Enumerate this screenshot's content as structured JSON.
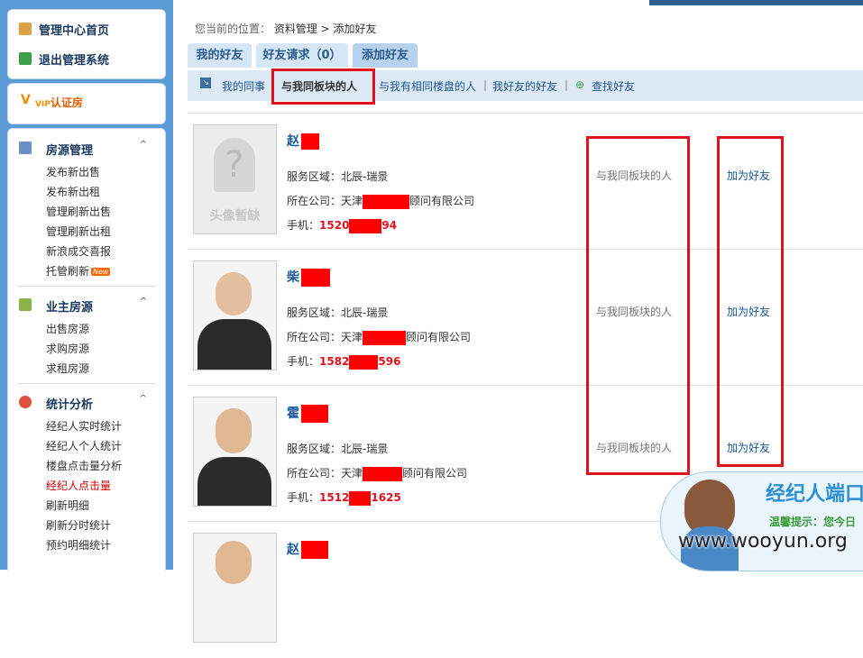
{
  "sidebar": {
    "top_links": [
      "管理中心首页",
      "退出管理系统"
    ],
    "vip_label": "认证房",
    "vip_prefix": "V",
    "sections": [
      {
        "title": "房源管理",
        "items": [
          "发布新出售",
          "发布新出租",
          "管理刷新出售",
          "管理刷新出租",
          "新浪成交喜报",
          "托管刷新"
        ]
      },
      {
        "title": "业主房源",
        "items": [
          "出售房源",
          "求购房源",
          "求租房源"
        ]
      },
      {
        "title": "统计分析",
        "items": [
          "经纪人实时统计",
          "经纪人个人统计",
          "楼盘点击量分析",
          "经纪人点击量",
          "刷新明细",
          "刷新分时统计",
          "预约明细统计"
        ]
      }
    ],
    "new_badge": "New",
    "caret": "^",
    "active_item": "经纪人点击量",
    "accent_color": "#5b9bd5"
  },
  "breadcrumb": {
    "prefix": "您当前的位置：",
    "path": "资料管理 > 添加好友"
  },
  "tabs": [
    "我的好友",
    "好友请求（0）",
    "添加好友"
  ],
  "subnav": {
    "items": [
      "我的同事",
      "与我同板块的人",
      "与我有相同楼盘的人",
      "我好友的好友",
      "查找好友"
    ],
    "separator": "|",
    "current": "与我同板块的人"
  },
  "people": [
    {
      "name": "赵",
      "area_label": "服务区域：",
      "area": "北辰-瑞景",
      "company_label": "所在公司：",
      "company_a": "天津",
      "company_b": "顾问有限公司",
      "phone_label": "手机：",
      "phone_a": "1520",
      "phone_b": "94",
      "relation": "与我同板块的人",
      "action": "加为好友",
      "avatar_text": "头像暂缺"
    },
    {
      "name": "柴",
      "area_label": "服务区域：",
      "area": "北辰-瑞景",
      "company_label": "所在公司：",
      "company_a": "天津",
      "company_b": "顾问有限公司",
      "phone_label": "手机：",
      "phone_a": "1582",
      "phone_b": "596",
      "relation": "与我同板块的人",
      "action": "加为好友",
      "avatar_text": ""
    },
    {
      "name": "霍",
      "area_label": "服务区域：",
      "area": "北辰-瑞景",
      "company_label": "所在公司：",
      "company_a": "天津",
      "company_b": "顾问有限公司",
      "phone_label": "手机：",
      "phone_a": "1512",
      "phone_b": "1625",
      "relation": "与我同板块的人",
      "action": "加为好友",
      "avatar_text": ""
    },
    {
      "name": "赵",
      "area_label": "",
      "area": "",
      "company_label": "",
      "company_a": "",
      "company_b": "",
      "phone_label": "",
      "phone_a": "",
      "phone_b": "",
      "relation": "",
      "action": "",
      "avatar_text": ""
    }
  ],
  "promo": {
    "title": "经纪人端口",
    "tip": "温馨提示：您今日"
  },
  "watermark": "www.wooyun.org"
}
